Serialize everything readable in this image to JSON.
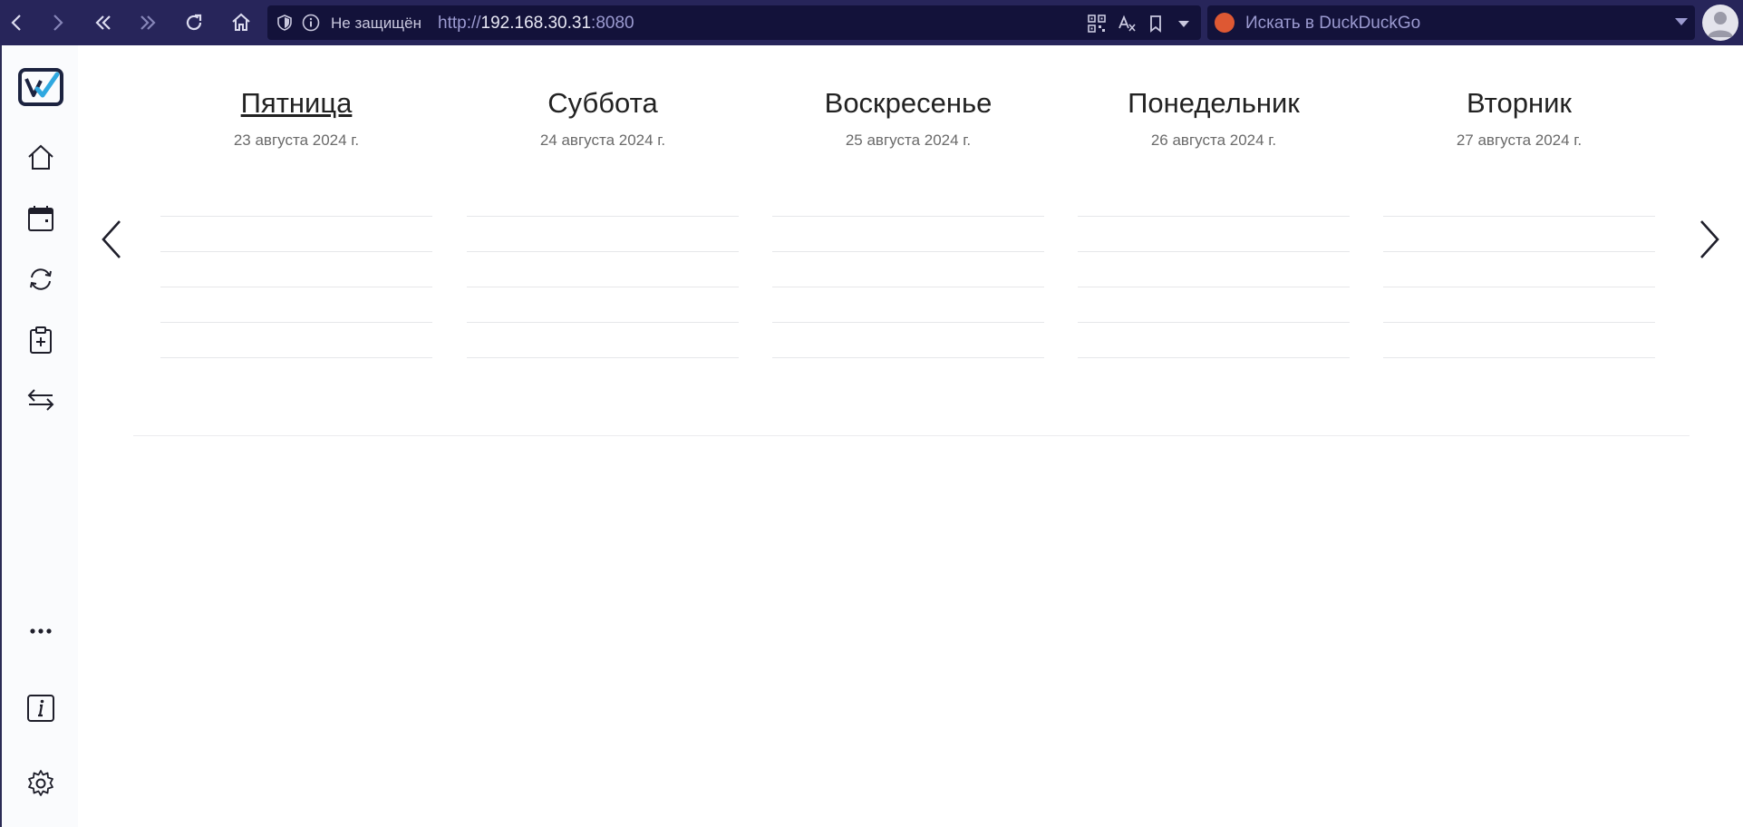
{
  "browser": {
    "url_security": "Не защищён",
    "url_scheme": "http://",
    "url_host": "192.168.30.31",
    "url_port": ":8080",
    "search_placeholder": "Искать в DuckDuckGo"
  },
  "sidebar": {
    "items": [
      {
        "name": "home-icon"
      },
      {
        "name": "calendar-icon"
      },
      {
        "name": "sync-icon"
      },
      {
        "name": "clipboard-add-icon"
      },
      {
        "name": "transfer-icon"
      },
      {
        "name": "more-icon"
      },
      {
        "name": "info-icon"
      },
      {
        "name": "settings-icon"
      }
    ]
  },
  "days": [
    {
      "name": "Пятница",
      "date": "23 августа 2024 г.",
      "today": true
    },
    {
      "name": "Суббота",
      "date": "24 августа 2024 г.",
      "today": false
    },
    {
      "name": "Воскресенье",
      "date": "25 августа 2024 г.",
      "today": false
    },
    {
      "name": "Понедельник",
      "date": "26 августа 2024 г.",
      "today": false
    },
    {
      "name": "Вторник",
      "date": "27 августа 2024 г.",
      "today": false
    }
  ],
  "colors": {
    "toolbar": "#27255a",
    "urlbar": "#13123a",
    "logo_dark": "#1c2340",
    "logo_accent": "#2fa8e0"
  }
}
